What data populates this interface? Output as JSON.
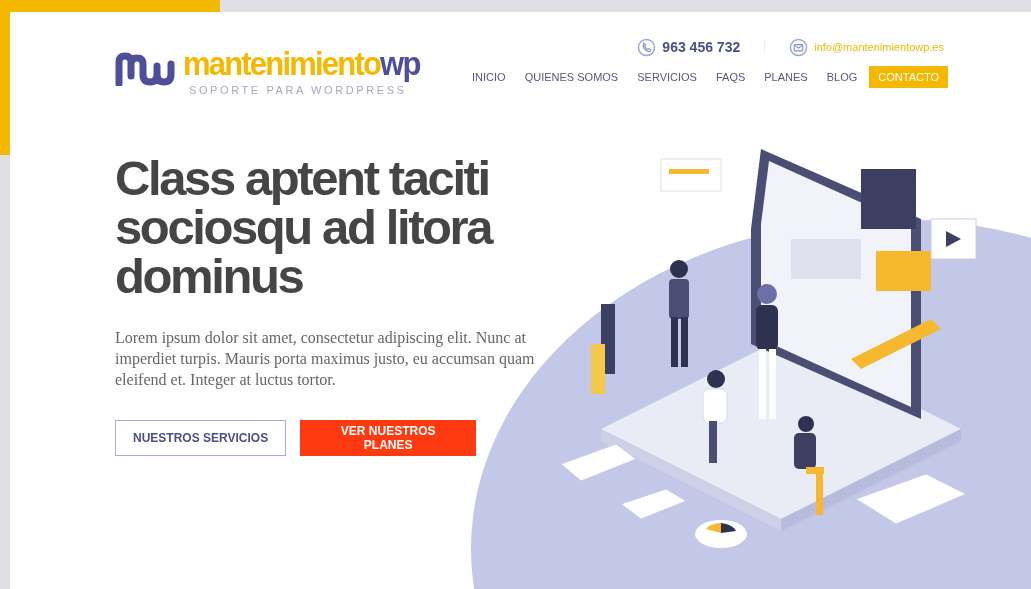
{
  "logo": {
    "wordmark_main": "mantenimiento",
    "wordmark_accent": "wp",
    "tagline": "SOPORTE PARA WORDPRESS"
  },
  "contact": {
    "phone": "963 456 732",
    "email": "info@mantenimientowp.es"
  },
  "nav": [
    {
      "label": "INICIO",
      "kind": "link"
    },
    {
      "label": "QUIENES SOMOS",
      "kind": "link"
    },
    {
      "label": "SERVICIOS",
      "kind": "link"
    },
    {
      "label": "FAQS",
      "kind": "link"
    },
    {
      "label": "PLANES",
      "kind": "link"
    },
    {
      "label": "BLOG",
      "kind": "link"
    },
    {
      "label": "CONTACTO",
      "kind": "cta"
    }
  ],
  "hero": {
    "title": "Class aptent taciti sociosqu ad litora dominus",
    "text": "Lorem ipsum dolor sit amet, consectetur adipiscing elit. Nunc at imperdiet turpis. Mauris porta maximus justo, eu accumsan quam eleifend et. Integer at luctus tortor.",
    "buttons": [
      {
        "label": "NUESTROS SERVICIOS",
        "kind": "outline"
      },
      {
        "label": "VER NUESTROS PLANES",
        "kind": "solid"
      }
    ]
  }
}
